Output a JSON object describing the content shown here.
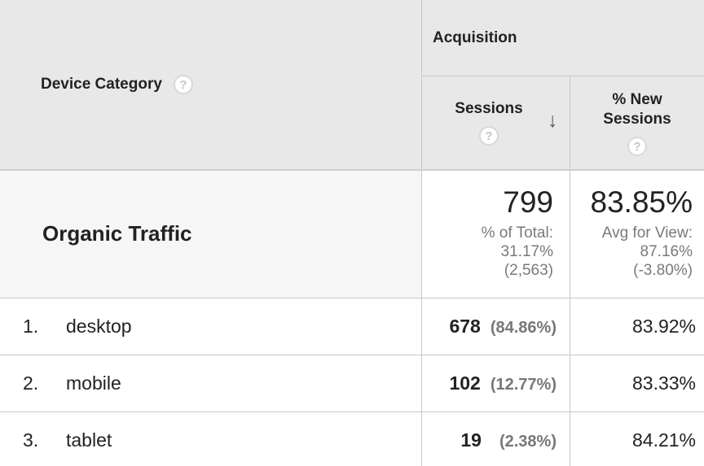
{
  "header": {
    "device_category": "Device Category",
    "acquisition": "Acquisition",
    "sessions": "Sessions",
    "new_sessions_line1": "% New",
    "new_sessions_line2": "Sessions",
    "help_glyph": "?",
    "sort_glyph": "↓"
  },
  "summary": {
    "label": "Organic Traffic",
    "sessions": "799",
    "sessions_line1": "% of Total:",
    "sessions_line2": "31.17%",
    "sessions_line3": "(2,563)",
    "new_sessions": "83.85%",
    "new_line1": "Avg for View:",
    "new_line2": "87.16%",
    "new_line3": "(-3.80%)"
  },
  "rows": [
    {
      "index": "1.",
      "device": "desktop",
      "sessions": "678",
      "sessions_pct": "(84.86%)",
      "new_sessions": "83.92%"
    },
    {
      "index": "2.",
      "device": "mobile",
      "sessions": "102",
      "sessions_pct": "(12.77%)",
      "new_sessions": "83.33%"
    },
    {
      "index": "3.",
      "device": "tablet",
      "sessions": "19",
      "sessions_pct": "(2.38%)",
      "new_sessions": "84.21%"
    }
  ]
}
